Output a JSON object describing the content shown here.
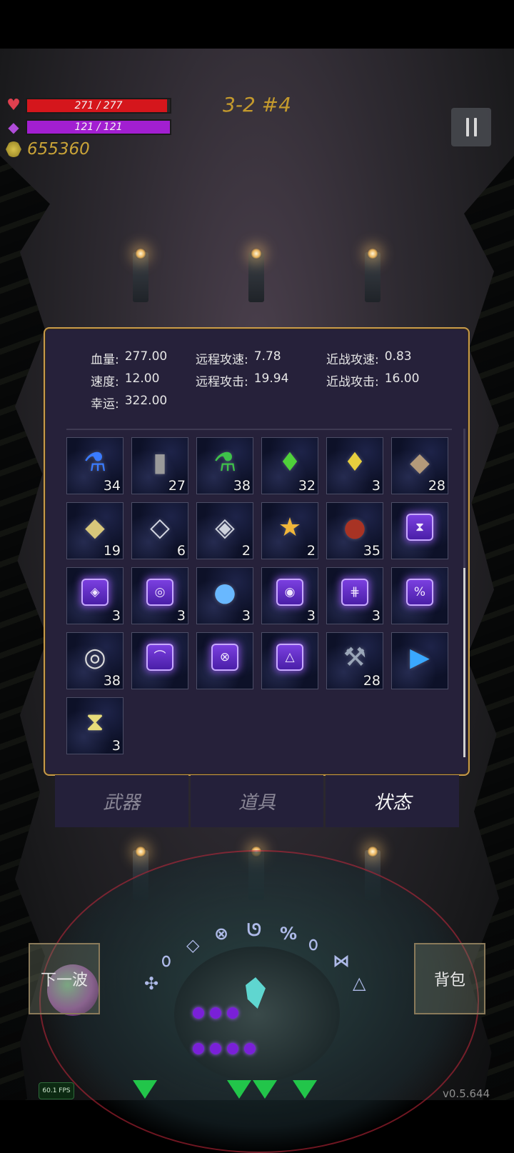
{
  "hud": {
    "hp_text": "271 / 277",
    "hp_fraction": 0.978,
    "mp_text": "121 / 121",
    "mp_fraction": 1.0,
    "gold": "655360",
    "wave": "3-2 #4"
  },
  "stats": {
    "row1": [
      {
        "label": "血量:",
        "value": "277.00"
      },
      {
        "label": "远程攻速:",
        "value": "7.78"
      },
      {
        "label": "近战攻速:",
        "value": "0.83"
      }
    ],
    "row2": [
      {
        "label": "速度:",
        "value": "12.00"
      },
      {
        "label": "远程攻击:",
        "value": "19.94"
      },
      {
        "label": "近战攻击:",
        "value": "16.00"
      }
    ],
    "row3": [
      {
        "label": "幸运:",
        "value": "322.00"
      }
    ]
  },
  "inventory": [
    {
      "icon": "blue-potion-icon",
      "count": "34"
    },
    {
      "icon": "tombstone-icon",
      "count": "27"
    },
    {
      "icon": "green-potion-icon",
      "count": "38"
    },
    {
      "icon": "green-crystal-icon",
      "count": "32"
    },
    {
      "icon": "yellow-crystal-icon",
      "count": "3"
    },
    {
      "icon": "stone-chunks-icon",
      "count": "28"
    },
    {
      "icon": "gold-ore-icon",
      "count": "19"
    },
    {
      "icon": "silver-plate-icon",
      "count": "6"
    },
    {
      "icon": "silver-cluster-icon",
      "count": "2"
    },
    {
      "icon": "star-trophy-icon",
      "count": "2"
    },
    {
      "icon": "red-sack-icon",
      "count": "35"
    },
    {
      "icon": "hourglass-rune-icon",
      "count": ""
    },
    {
      "icon": "eye-rune-icon",
      "count": "3"
    },
    {
      "icon": "spiral-rune-icon",
      "count": "3"
    },
    {
      "icon": "blue-orb-icon",
      "count": "3"
    },
    {
      "icon": "swirl-rune-icon",
      "count": "3"
    },
    {
      "icon": "split-rune-icon",
      "count": "3"
    },
    {
      "icon": "percent-rune-icon",
      "count": ""
    },
    {
      "icon": "rings-icon",
      "count": "38"
    },
    {
      "icon": "arc-rune-icon",
      "count": ""
    },
    {
      "icon": "cross-rune-icon",
      "count": ""
    },
    {
      "icon": "triangle-rune-icon",
      "count": ""
    },
    {
      "icon": "axe-icon",
      "count": "28"
    },
    {
      "icon": "spellbook-icon",
      "count": ""
    },
    {
      "icon": "gold-card-icon",
      "count": "3"
    }
  ],
  "tabs": [
    {
      "label": "武器",
      "active": false
    },
    {
      "label": "道具",
      "active": false
    },
    {
      "label": "状态",
      "active": true
    }
  ],
  "buttons": {
    "next_wave": "下一波",
    "backpack": "背包"
  },
  "fps": "60.1 FPS",
  "version": "v0.5.644",
  "colors": {
    "hp": "#d5161c",
    "mp": "#a21fd1",
    "gold": "#caa438",
    "panel_border": "#c79a4a",
    "panel_bg": "#26213a"
  }
}
